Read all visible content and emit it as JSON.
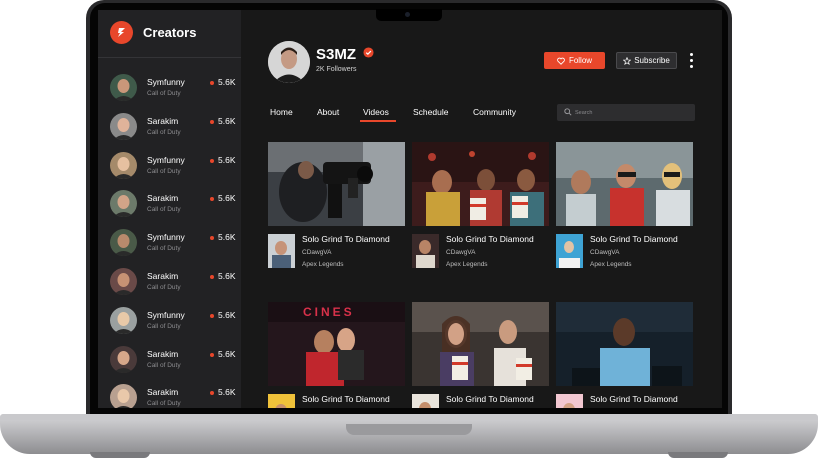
{
  "sidebar": {
    "title": "Creators",
    "creators": [
      {
        "name": "Symfunny",
        "game": "Call of Duty",
        "views": "5.6K"
      },
      {
        "name": "Sarakim",
        "game": "Call of Duty",
        "views": "5.6K"
      },
      {
        "name": "Symfunny",
        "game": "Call of Duty",
        "views": "5.6K"
      },
      {
        "name": "Sarakim",
        "game": "Call of Duty",
        "views": "5.6K"
      },
      {
        "name": "Symfunny",
        "game": "Call of Duty",
        "views": "5.6K"
      },
      {
        "name": "Sarakim",
        "game": "Call of Duty",
        "views": "5.6K"
      },
      {
        "name": "Symfunny",
        "game": "Call of Duty",
        "views": "5.6K"
      },
      {
        "name": "Sarakim",
        "game": "Call of Duty",
        "views": "5.6K"
      },
      {
        "name": "Sarakim",
        "game": "Call of Duty",
        "views": "5.6K"
      }
    ]
  },
  "channel": {
    "name": "S3MZ",
    "followers": "2K Followers",
    "follow_label": "Follow",
    "subscribe_label": "Subscribe"
  },
  "tabs": [
    {
      "label": "Home"
    },
    {
      "label": "About"
    },
    {
      "label": "Videos",
      "active": true
    },
    {
      "label": "Schedule"
    },
    {
      "label": "Community"
    }
  ],
  "search": {
    "placeholder": "Search"
  },
  "videos": [
    {
      "title": "Solo Grind To Diamond",
      "channel": "CDawgVA",
      "game": "Apex Legends"
    },
    {
      "title": "Solo Grind To Diamond",
      "channel": "CDawgVA",
      "game": "Apex Legends"
    },
    {
      "title": "Solo Grind To Diamond",
      "channel": "CDawgVA",
      "game": "Apex Legends"
    },
    {
      "title": "Solo Grind To Diamond",
      "channel": "",
      "game": ""
    },
    {
      "title": "Solo Grind To Diamond",
      "channel": "",
      "game": ""
    },
    {
      "title": "Solo Grind To Diamond",
      "channel": "",
      "game": ""
    }
  ],
  "thumbnail_signs": {
    "cinema_sign": "CINES"
  },
  "colors": {
    "accent": "#e8472b",
    "background": "#181818",
    "sidebar": "#222224"
  }
}
